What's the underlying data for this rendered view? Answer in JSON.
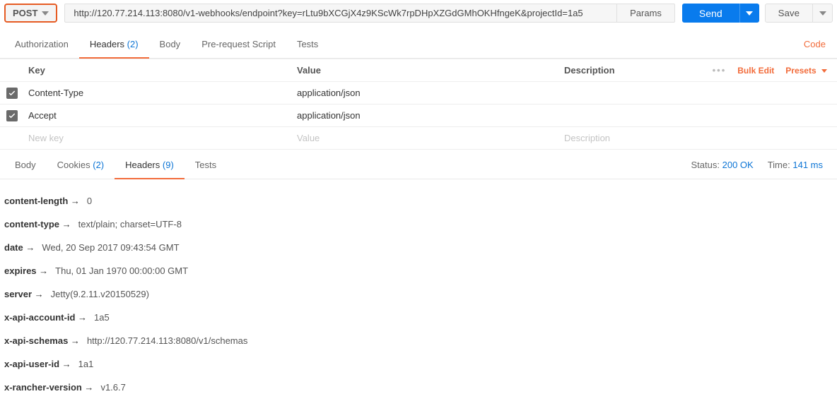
{
  "request": {
    "method": "POST",
    "url": "http://120.77.214.113:8080/v1-webhooks/endpoint?key=rLtu9bXCGjX4z9KScWk7rpDHpXZGdGMhOKHfngeK&projectId=1a5",
    "params_label": "Params",
    "send_label": "Send",
    "save_label": "Save"
  },
  "req_tabs": {
    "authorization": "Authorization",
    "headers": "Headers",
    "headers_count": "(2)",
    "body": "Body",
    "prereq": "Pre-request Script",
    "tests": "Tests",
    "code": "Code"
  },
  "headers_table": {
    "cols": {
      "key": "Key",
      "value": "Value",
      "desc": "Description"
    },
    "bulk": "Bulk Edit",
    "presets": "Presets",
    "rows": [
      {
        "key": "Content-Type",
        "value": "application/json",
        "desc": ""
      },
      {
        "key": "Accept",
        "value": "application/json",
        "desc": ""
      }
    ],
    "placeholder": {
      "key": "New key",
      "value": "Value",
      "desc": "Description"
    }
  },
  "resp_tabs": {
    "body": "Body",
    "cookies": "Cookies",
    "cookies_count": "(2)",
    "headers": "Headers",
    "headers_count": "(9)",
    "tests": "Tests"
  },
  "resp_meta": {
    "status_label": "Status:",
    "status_value": "200 OK",
    "time_label": "Time:",
    "time_value": "141 ms"
  },
  "resp_headers": [
    {
      "key": "content-length",
      "value": "0"
    },
    {
      "key": "content-type",
      "value": "text/plain; charset=UTF-8"
    },
    {
      "key": "date",
      "value": "Wed, 20 Sep 2017 09:43:54 GMT"
    },
    {
      "key": "expires",
      "value": "Thu, 01 Jan 1970 00:00:00 GMT"
    },
    {
      "key": "server",
      "value": "Jetty(9.2.11.v20150529)"
    },
    {
      "key": "x-api-account-id",
      "value": "1a5"
    },
    {
      "key": "x-api-schemas",
      "value": "http://120.77.214.113:8080/v1/schemas"
    },
    {
      "key": "x-api-user-id",
      "value": "1a1"
    },
    {
      "key": "x-rancher-version",
      "value": "v1.6.7"
    }
  ]
}
